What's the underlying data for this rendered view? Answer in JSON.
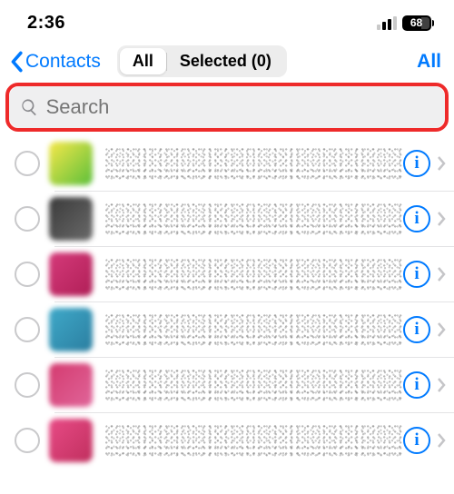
{
  "status": {
    "time": "2:36",
    "battery_pct": "68"
  },
  "nav": {
    "back_label": "Contacts",
    "seg_all": "All",
    "seg_selected": "Selected (0)",
    "right_action": "All"
  },
  "search": {
    "placeholder": "Search"
  },
  "contacts": [
    {
      "avatar_colors": [
        "#f7e84a",
        "#5bbf3a"
      ]
    },
    {
      "avatar_colors": [
        "#3a3a3a",
        "#6a6a6a"
      ]
    },
    {
      "avatar_colors": [
        "#d53a7a",
        "#b01f57"
      ]
    },
    {
      "avatar_colors": [
        "#3fa9c9",
        "#2b7ea0"
      ]
    },
    {
      "avatar_colors": [
        "#d43a6f",
        "#e0669a"
      ]
    },
    {
      "avatar_colors": [
        "#e84b86",
        "#c02f5e"
      ]
    }
  ],
  "info_glyph": "i"
}
